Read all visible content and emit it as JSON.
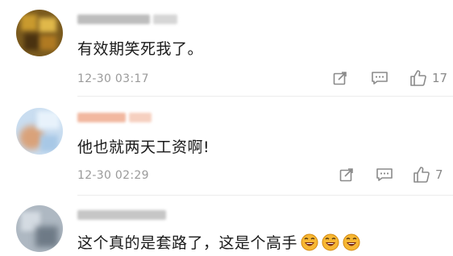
{
  "comments": [
    {
      "text": "有效期笑死我了。",
      "time": "12-30 03:17",
      "like_count": "17",
      "icons": [
        "share-icon",
        "comment-icon",
        "thumbs-up-icon"
      ]
    },
    {
      "text": "他也就两天工资啊!",
      "time": "12-30 02:29",
      "like_count": "7",
      "icons": [
        "share-icon",
        "comment-icon",
        "thumbs-up-icon"
      ]
    },
    {
      "text": "这个真的是套路了，这是个高手",
      "emoji": [
        "laughing-emoji",
        "laughing-emoji",
        "laughing-emoji"
      ]
    }
  ],
  "colors": {
    "text": "#1a1a1a",
    "muted": "#9a9a9a",
    "icon": "#8a8a8a",
    "emoji_face": "#f7b733"
  }
}
